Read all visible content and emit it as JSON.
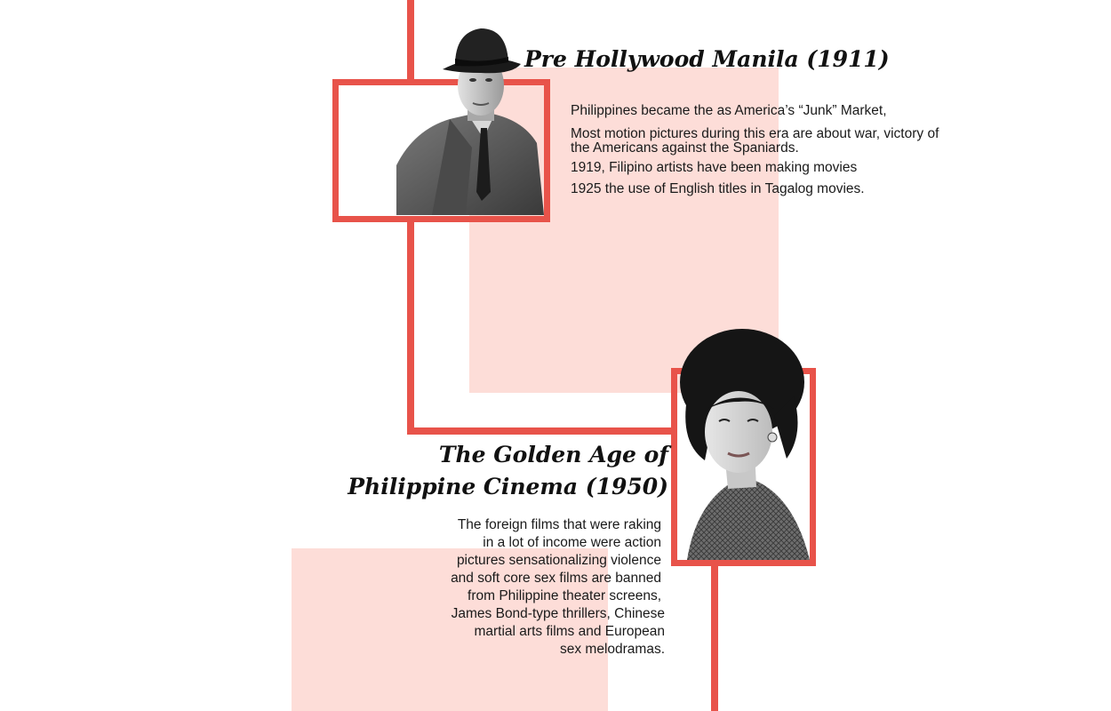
{
  "section1": {
    "title": "Pre Hollywood Manila (1911)",
    "paragraphs": [
      "Philippines became the as America’s “Junk” Market,",
      "Most motion pictures during this era are about war, victory of the Americans against the Spaniards.",
      "1919, Filipino artists have been making movies",
      "1925 the use of English titles in Tagalog movies."
    ]
  },
  "section2": {
    "title_line1": "The Golden Age of",
    "title_line2": "Philippine Cinema  (1950)",
    "lines": [
      "The foreign films that were raking",
      "in a lot of income were action",
      "pictures sensationalizing violence",
      "and soft core sex films are banned",
      "from Philippine theater screens,",
      "James Bond-type thrillers, Chinese",
      "martial arts films and European",
      "sex melodramas."
    ]
  },
  "colors": {
    "accent": "#e8534a",
    "blush": "#fdddd8"
  }
}
